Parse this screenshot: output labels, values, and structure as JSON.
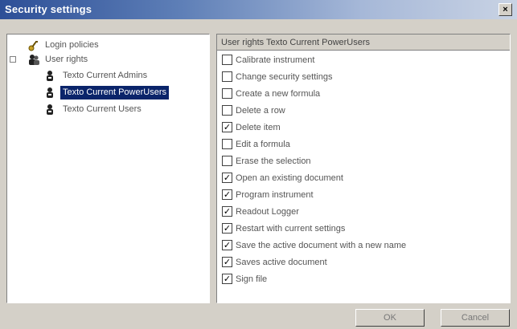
{
  "window": {
    "title": "Security settings",
    "close_label": "×"
  },
  "tree": {
    "items": [
      {
        "label": "Login policies",
        "icon": "key-icon"
      },
      {
        "label": "User rights",
        "icon": "users-icon"
      },
      {
        "label": "Texto Current Admins",
        "icon": "group-icon"
      },
      {
        "label": "Texto Current PowerUsers",
        "icon": "group-icon",
        "selected": true
      },
      {
        "label": "Texto Current Users",
        "icon": "group-icon"
      }
    ]
  },
  "permissions": {
    "header": "User rights Texto Current PowerUsers",
    "items": [
      {
        "label": "Calibrate instrument",
        "checked": false
      },
      {
        "label": "Change security settings",
        "checked": false
      },
      {
        "label": "Create a new formula",
        "checked": false
      },
      {
        "label": "Delete a row",
        "checked": false
      },
      {
        "label": "Delete item",
        "checked": true
      },
      {
        "label": "Edit a formula",
        "checked": false
      },
      {
        "label": "Erase the selection",
        "checked": false
      },
      {
        "label": "Open an existing document",
        "checked": true
      },
      {
        "label": "Program instrument",
        "checked": true
      },
      {
        "label": "Readout Logger",
        "checked": true
      },
      {
        "label": "Restart with current settings",
        "checked": true
      },
      {
        "label": "Save the active document with a new name",
        "checked": true
      },
      {
        "label": "Saves active document",
        "checked": true
      },
      {
        "label": "Sign file",
        "checked": true
      }
    ]
  },
  "buttons": {
    "ok": "OK",
    "cancel": "Cancel"
  },
  "colors": {
    "selection": "#0a246a",
    "title_start": "#2d4f97",
    "face": "#d4d0c8"
  }
}
